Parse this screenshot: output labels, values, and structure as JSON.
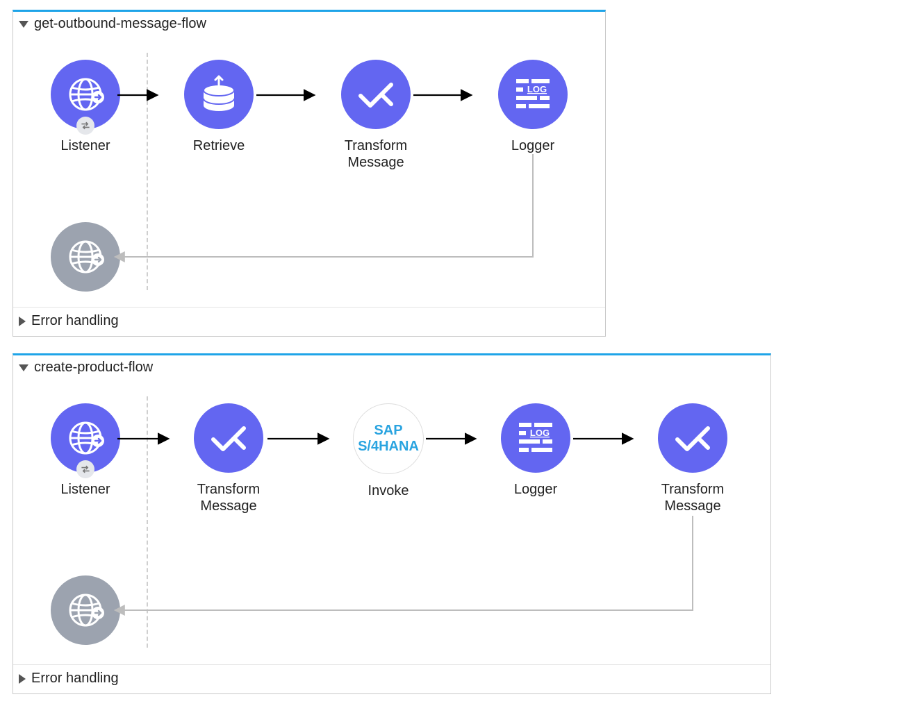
{
  "flows": [
    {
      "title": "get-outbound-message-flow",
      "error_label": "Error handling",
      "nodes": {
        "listener": "Listener",
        "retrieve": "Retrieve",
        "transform": "Transform Message",
        "logger": "Logger"
      }
    },
    {
      "title": "create-product-flow",
      "error_label": "Error handling",
      "nodes": {
        "listener": "Listener",
        "transform1": "Transform Message",
        "invoke": "Invoke",
        "invoke_icon_line1": "SAP",
        "invoke_icon_line2": "S/4HANA",
        "logger": "Logger",
        "transform2": "Transform Message"
      }
    }
  ]
}
